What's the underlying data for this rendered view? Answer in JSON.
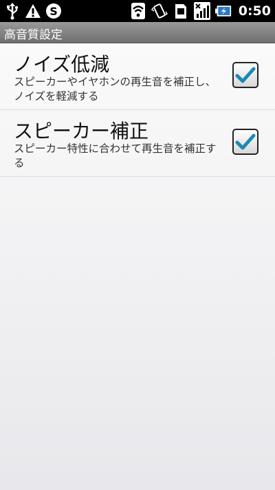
{
  "status_bar": {
    "time": "0:50",
    "left_icons": [
      "usb-icon",
      "warning-icon",
      "skype-icon"
    ],
    "right_icons": [
      "wifi-icon",
      "vibrate-icon",
      "sd-card-icon",
      "signal-icon",
      "battery-charging-icon"
    ]
  },
  "title_bar": {
    "title": "高音質設定"
  },
  "preferences": [
    {
      "title": "ノイズ低減",
      "summary": "スピーカーやイヤホンの再生音を補正し、ノイズを軽減する",
      "checked": true
    },
    {
      "title": "スピーカー補正",
      "summary": "スピーカー特性に合わせて再生音を補正する",
      "checked": true
    }
  ],
  "colors": {
    "status_bg": "#000000",
    "title_bar_bg": "#808080",
    "check_accent": "#1a8ab5"
  }
}
